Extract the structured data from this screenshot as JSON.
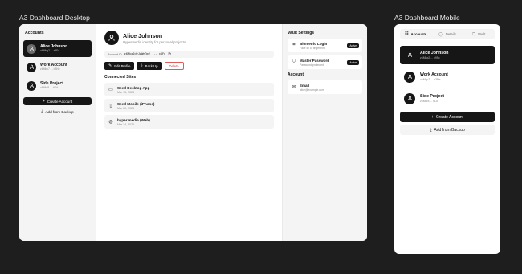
{
  "boards": {
    "desktop_title": "A3 Dashboard Desktop",
    "mobile_title": "A3 Dashboard Mobile"
  },
  "sidebar": {
    "heading": "Accounts",
    "accounts": [
      {
        "name": "Alice Johnson",
        "id": "z6Mkq2 ... x9Fc"
      },
      {
        "name": "Work Account",
        "id": "z6Mkp7 ... b3Ne"
      },
      {
        "name": "Side Project",
        "id": "z6Mkr8 ... t4Jd"
      }
    ],
    "create_label": "Create Account",
    "backup_label": "Add from Backup"
  },
  "profile": {
    "name": "Alice Johnson",
    "subtitle": "Hypermedia identity for personal projects",
    "account_id_label": "Account ID",
    "account_id": "z6Mkq2dyJwWnQp2 ... x9Fc",
    "edit_label": "Edit Profile",
    "backup_label": "Back Up",
    "delete_label": "Delete"
  },
  "connected": {
    "heading": "Connected Sites",
    "sites": [
      {
        "name": "Seed Desktop App",
        "date": "Mar 15, 2026",
        "icon": "monitor-icon"
      },
      {
        "name": "Seed Mobile (iPhone)",
        "date": "Mar 20, 2026",
        "icon": "phone-icon"
      },
      {
        "name": "hyper.media (Web)",
        "date": "Mar 24, 2026",
        "icon": "globe-icon"
      }
    ]
  },
  "vault": {
    "heading": "Vault Settings",
    "items": [
      {
        "name": "Biometric Login",
        "sub": "Face ID or fingerprint",
        "badge": "Active",
        "icon": "face-scan-icon"
      },
      {
        "name": "Master Password",
        "sub": "Password protected",
        "badge": "Active",
        "icon": "shield-icon"
      }
    ],
    "account_heading": "Account",
    "email_label": "Email",
    "email_value": "alice@example.com"
  },
  "mobile": {
    "tabs": [
      "Accounts",
      "Details",
      "Vault"
    ],
    "accounts": [
      {
        "name": "Alice Johnson",
        "id": "z6Mkq2 ... x9Fc"
      },
      {
        "name": "Work Account",
        "id": "z6Mkp7 ... b3Ne"
      },
      {
        "name": "Side Project",
        "id": "z6Mkr8 ... t4Jd"
      }
    ],
    "create_label": "Create Account",
    "backup_label": "Add from Backup"
  },
  "colors": {
    "accent": "#161616",
    "danger": "#d23b3b",
    "panel": "#f4f4f4",
    "canvas": "#1e1e1e"
  }
}
